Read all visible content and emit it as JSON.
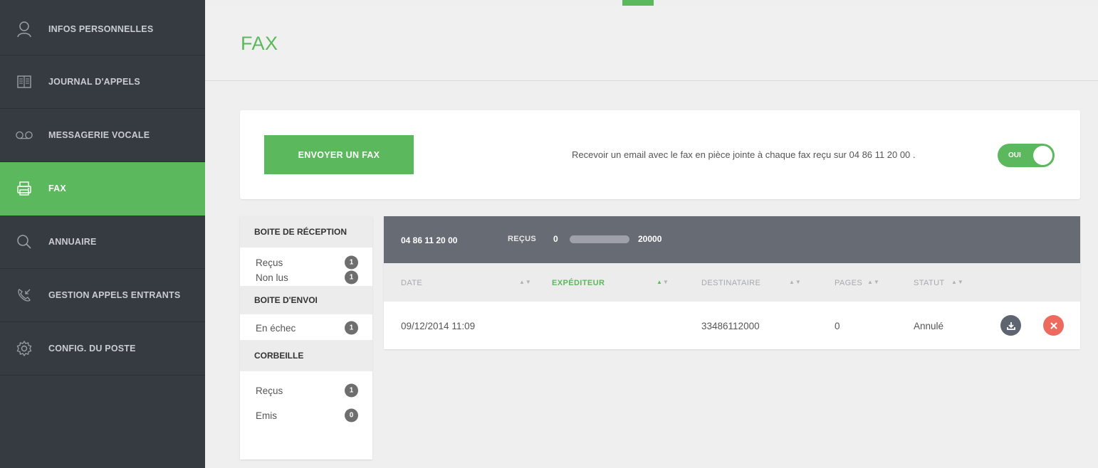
{
  "sidebar": {
    "items": [
      {
        "label": "INFOS PERSONNELLES",
        "icon": "user-icon"
      },
      {
        "label": "JOURNAL D'APPELS",
        "icon": "book-icon"
      },
      {
        "label": "MESSAGERIE VOCALE",
        "icon": "voicemail-icon"
      },
      {
        "label": "FAX",
        "icon": "printer-icon",
        "active": true
      },
      {
        "label": "ANNUAIRE",
        "icon": "search-icon"
      },
      {
        "label": "GESTION APPELS ENTRANTS",
        "icon": "incoming-call-icon"
      },
      {
        "label": "CONFIG. DU POSTE",
        "icon": "gear-icon"
      }
    ]
  },
  "page": {
    "title": "FAX"
  },
  "actions": {
    "send_label": "ENVOYER UN FAX",
    "email_text": "Recevoir un email avec le fax en pièce jointe à chaque fax reçu sur 04 86 11 20 00 .",
    "toggle_label": "OUI"
  },
  "folders": {
    "inbox_title": "BOITE DE RÉCEPTION",
    "inbox": [
      {
        "label": "Reçus",
        "count": "1"
      },
      {
        "label": "Non lus",
        "count": "1"
      }
    ],
    "outbox_title": "BOITE D'ENVOI",
    "outbox": [
      {
        "label": "En échec",
        "count": "1"
      }
    ],
    "trash_title": "CORBEILLE",
    "trash": [
      {
        "label": "Reçus",
        "count": "1"
      },
      {
        "label": "Emis",
        "count": "0"
      }
    ]
  },
  "fax_table": {
    "number": "04 86 11 20 00",
    "received_label": "REÇUS",
    "quota_min": "0",
    "quota_max": "20000",
    "quota_fill": 0,
    "columns": {
      "date": "DATE",
      "sender": "EXPÉDITEUR",
      "recipient": "DESTINATAIRE",
      "pages": "PAGES",
      "status": "STATUT"
    },
    "sort_glyph": "▲▼",
    "rows": [
      {
        "date": "09/12/2014 11:09",
        "sender": "",
        "recipient": "33486112000",
        "pages": "0",
        "status": "Annulé"
      }
    ]
  },
  "colors": {
    "accent": "#5cb85c",
    "sidebar": "#363b41",
    "table_header": "#676c74",
    "delete": "#ec6a5e"
  }
}
